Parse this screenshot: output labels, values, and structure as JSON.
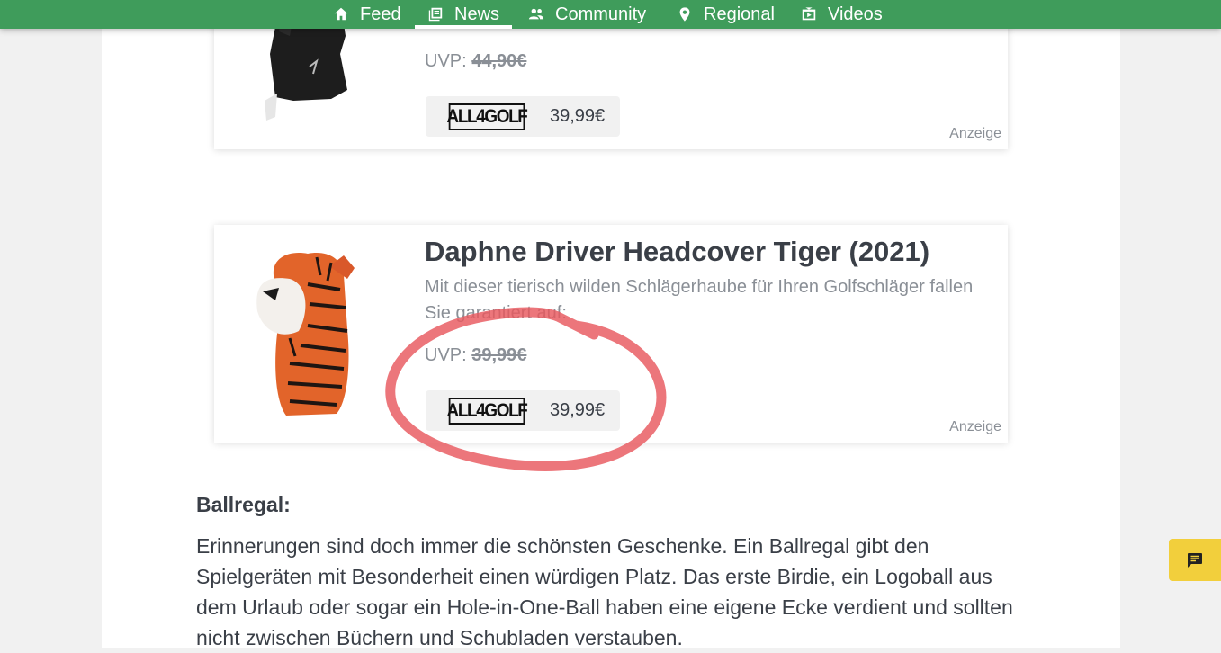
{
  "nav": {
    "items": [
      {
        "label": "Feed",
        "icon": "home-icon"
      },
      {
        "label": "News",
        "icon": "news-icon",
        "active": true
      },
      {
        "label": "Community",
        "icon": "people-icon"
      },
      {
        "label": "Regional",
        "icon": "location-pin-icon"
      },
      {
        "label": "Videos",
        "icon": "video-icon"
      }
    ],
    "bg_color": "#3f9c5b"
  },
  "products": [
    {
      "uvp_label": "UVP:",
      "uvp_price": "44,90€",
      "shop_logo": "ALL4GOLF",
      "shop_price": "39,99€",
      "ad_label": "Anzeige"
    },
    {
      "title": "Daphne Driver Headcover Tiger (2021)",
      "description": "Mit dieser tierisch wilden Schlägerhaube für Ihren Golfschläger fallen Sie garantiert auf:",
      "uvp_label": "UVP:",
      "uvp_price": "39,99€",
      "shop_logo": "ALL4GOLF",
      "shop_price": "39,99€",
      "ad_label": "Anzeige"
    }
  ],
  "article": {
    "heading": "Ballregal:",
    "paragraph": "Erinnerungen sind doch immer die schönsten Geschenke. Ein Ballregal gibt den Spielgeräten mit Besonderheit einen würdigen Platz. Das erste Birdie, ein Logoball aus dem Urlaub oder sogar ein Hole-in-One-Ball haben eine eigene Ecke verdient und sollten nicht zwischen Büchern und Schubladen verstauben."
  },
  "feedback_button": {
    "icon": "feedback-icon",
    "color": "#f2cf3c"
  },
  "annotation": {
    "color": "#e8585e"
  }
}
